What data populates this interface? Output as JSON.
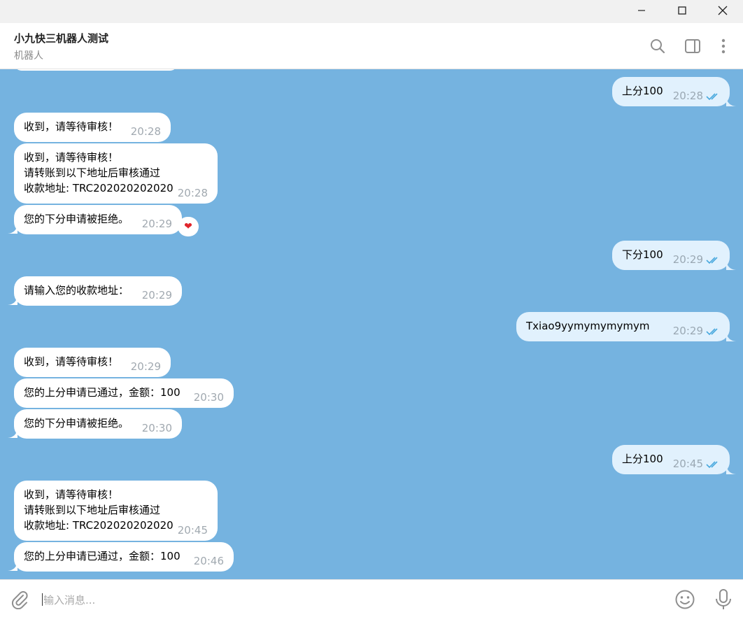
{
  "header": {
    "title": "小九快三机器人测试",
    "subtitle": "机器人"
  },
  "colors": {
    "chat_background": "#75b3e0",
    "incoming_bubble": "#ffffff",
    "outgoing_bubble": "#e1f1fd",
    "read_check": "#4aa9de"
  },
  "icons": {
    "window": [
      "minimize-icon",
      "maximize-icon",
      "close-icon"
    ],
    "header": [
      "search-icon",
      "sidebar-toggle-icon",
      "more-vertical-icon"
    ],
    "input": [
      "attach-icon",
      "emoji-icon",
      "microphone-icon"
    ],
    "message_status": "double-check-icon"
  },
  "messages": [
    {
      "dir": "out",
      "text": "上分100",
      "time": "20:28",
      "read": true
    },
    {
      "dir": "in",
      "text": "收到，请等待审核！",
      "time": "20:28"
    },
    {
      "dir": "in",
      "text": "收到，请等待审核！\n请转账到以下地址后审核通过\n收款地址: TRC202020202020",
      "time": "20:28"
    },
    {
      "dir": "in",
      "text": "您的下分申请被拒绝。",
      "time": "20:29",
      "reaction": "❤"
    },
    {
      "dir": "out",
      "text": "下分100",
      "time": "20:29",
      "read": true
    },
    {
      "dir": "in",
      "text": "请输入您的收款地址：",
      "time": "20:29"
    },
    {
      "dir": "out",
      "text": "Txiao9yymymymymym",
      "time": "20:29",
      "read": true
    },
    {
      "dir": "in",
      "text": "收到，请等待审核！",
      "time": "20:29"
    },
    {
      "dir": "in",
      "text": "您的上分申请已通过，金额：100",
      "time": "20:30"
    },
    {
      "dir": "in",
      "text": "您的下分申请被拒绝。",
      "time": "20:30"
    },
    {
      "dir": "out",
      "text": "上分100",
      "time": "20:45",
      "read": true
    },
    {
      "dir": "in",
      "text": "收到，请等待审核！\n请转账到以下地址后审核通过\n收款地址: TRC202020202020",
      "time": "20:45"
    },
    {
      "dir": "in",
      "text": "您的上分申请已通过，金额：100",
      "time": "20:46"
    }
  ],
  "input": {
    "placeholder": "输入消息..."
  }
}
